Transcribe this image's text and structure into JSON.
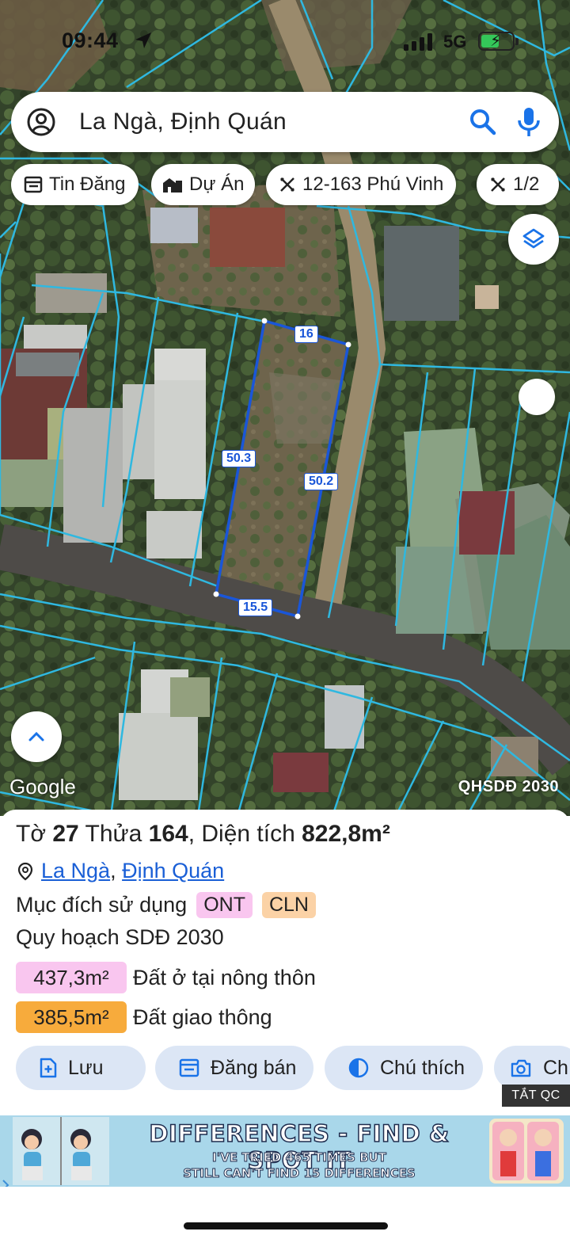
{
  "status": {
    "time": "09:44",
    "network": "5G"
  },
  "search": {
    "text": "La Ngà, Định Quán"
  },
  "chips": [
    {
      "label": "Tin Đăng",
      "icon": "listing-icon"
    },
    {
      "label": "Dự Án",
      "icon": "buildings-icon"
    },
    {
      "label": "12-163 Phú Vinh",
      "icon": "ruler-icon"
    },
    {
      "label": "1/2",
      "icon": "ruler-icon"
    }
  ],
  "map": {
    "edges": {
      "top": "16",
      "left": "50.3",
      "right": "50.2",
      "bottom": "15.5"
    },
    "google_logo": "Google",
    "plan_label": "QHSDĐ 2030"
  },
  "parcel": {
    "sheet_label": "Tờ",
    "sheet_no": "27",
    "plot_label": "Thửa",
    "plot_no": "164",
    "area_label": ", Diện tích",
    "area": "822,8m²",
    "commune": "La Ngà",
    "district": "Định Quán",
    "purpose_label": "Mục đích sử dụng",
    "purpose_tags": [
      {
        "code": "ONT",
        "color": "#f9c6ef"
      },
      {
        "code": "CLN",
        "color": "#fbd2a6"
      }
    ],
    "plan_title": "Quy hoạch SDĐ 2030",
    "zones": [
      {
        "area": "437,3m²",
        "label": "Đất ở tại nông thôn",
        "color": "#f9c6ef"
      },
      {
        "area": "385,5m²",
        "label": "Đất giao thông",
        "color": "#f7ab3c"
      }
    ]
  },
  "actions": [
    {
      "label": "Lưu"
    },
    {
      "label": "Đăng bán"
    },
    {
      "label": "Chú thích"
    },
    {
      "label": "Ch"
    }
  ],
  "ad": {
    "close_label": "TẮT QC",
    "title": "DIFFERENCES - FIND & SPOT IT",
    "line1": "I'VE TRIED 465 TIMES BUT",
    "line2": "STILL CAN'T FIND 15 DIFFERENCES"
  },
  "colors": {
    "accent": "#1a73e8",
    "parcel_line": "#1a56d8",
    "boundary": "#2fb8e0"
  }
}
